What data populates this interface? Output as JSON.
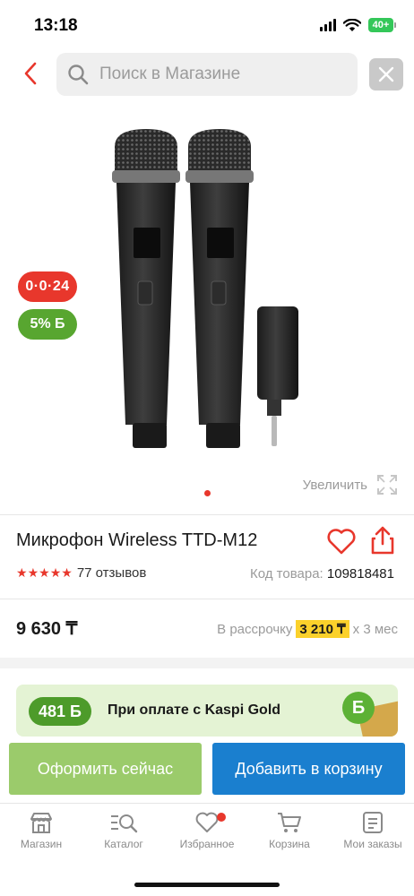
{
  "status_bar": {
    "time": "13:18",
    "battery": "40+"
  },
  "header": {
    "search_placeholder": "Поиск в Магазине",
    "icons": [
      "back-arrow-icon",
      "search-icon",
      "close-icon"
    ]
  },
  "gallery": {
    "badge_installment": "0·0·24",
    "badge_bonus": "5% Б",
    "zoom_label": "Увеличить",
    "current_slide": 1
  },
  "product": {
    "title": "Микрофон Wireless TTD-M12",
    "rating": 4.5,
    "reviews_label": "77 отзывов",
    "sku_label": "Код товара:",
    "sku_value": "109818481",
    "price": "9 630 ₸",
    "installment_prefix": "В рассрочку",
    "installment_amount": "3 210 ₸",
    "installment_suffix": "x 3 мес"
  },
  "gold_banner": {
    "bonus": "481 Б",
    "text": "При оплате с Kaspi Gold",
    "coin": "Б"
  },
  "actions": {
    "checkout": "Оформить сейчас",
    "add_to_cart": "Добавить в корзину"
  },
  "bottom_nav": {
    "items": [
      {
        "label": "Магазин",
        "icon": "shop-icon"
      },
      {
        "label": "Каталог",
        "icon": "catalog-search-icon"
      },
      {
        "label": "Избранное",
        "icon": "heart-icon"
      },
      {
        "label": "Корзина",
        "icon": "cart-icon"
      },
      {
        "label": "Мои заказы",
        "icon": "orders-icon"
      }
    ]
  },
  "colors": {
    "accent_red": "#e8372c",
    "green": "#58a630",
    "blue": "#1a7fcf",
    "installment_yellow": "#fbd12b"
  }
}
